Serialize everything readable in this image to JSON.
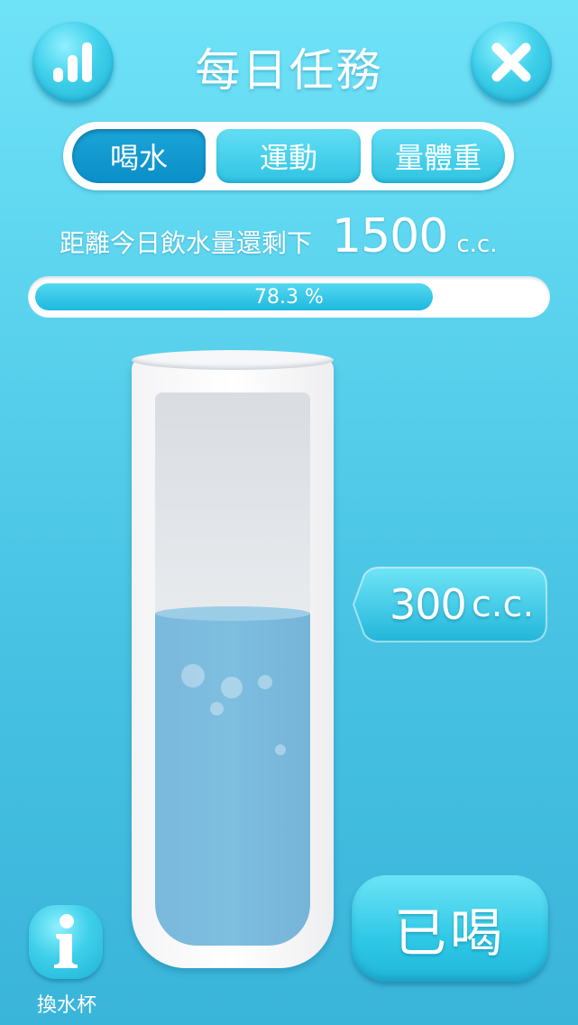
{
  "header": {
    "title": "每日任務",
    "stats_icon": "bar-chart-icon",
    "close_icon": "close-icon"
  },
  "tabs": [
    {
      "label": "喝水",
      "active": true
    },
    {
      "label": "運動",
      "active": false
    },
    {
      "label": "量體重",
      "active": false
    }
  ],
  "remaining": {
    "label": "距離今日飲水量還剩下",
    "value": "1500",
    "unit": "c.c."
  },
  "progress": {
    "percent": 78.3,
    "text": "78.3 %"
  },
  "cup": {
    "fill_fraction": 0.6
  },
  "amount": {
    "value": "300",
    "unit": "c.c."
  },
  "drink_button": {
    "label": "已喝"
  },
  "cup_switch": {
    "icon": "info-icon",
    "label": "換水杯"
  },
  "colors": {
    "accent": "#2fc4e3",
    "active_tab": "#0b8ec8",
    "water": "#7ab9dc"
  }
}
